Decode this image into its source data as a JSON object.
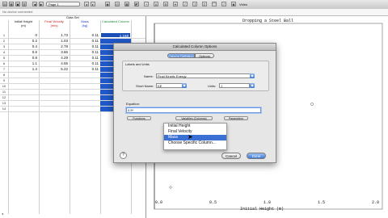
{
  "toolbar": {
    "page_label": "Page 1",
    "video_label": "Video",
    "subbar_text": "No device connected"
  },
  "table": {
    "header": "Data Set",
    "columns": [
      {
        "name": "Initial Height",
        "unit": "(m)"
      },
      {
        "name": "Final Velocity",
        "unit": "(m/s)"
      },
      {
        "name": "Mass",
        "unit": "(kg)"
      },
      {
        "name": "Calculated Column",
        "unit": ""
      }
    ],
    "rows": [
      {
        "n": "1",
        "h": "0",
        "v": "1.73",
        "m": "0.11",
        "c": "1.158"
      },
      {
        "n": "2",
        "h": "0.2",
        "v": "1.03",
        "m": "0.11",
        "c": ""
      },
      {
        "n": "3",
        "h": "0.4",
        "v": "2.78",
        "m": "0.11",
        "c": ""
      },
      {
        "n": "4",
        "h": "0.6",
        "v": "3.66",
        "m": "0.11",
        "c": ""
      },
      {
        "n": "5",
        "h": "0.8",
        "v": "4.29",
        "m": "0.11",
        "c": ""
      },
      {
        "n": "6",
        "h": "1.1",
        "v": "4.65",
        "m": "0.11",
        "c": ""
      },
      {
        "n": "7",
        "h": "1.4",
        "v": "5.22",
        "m": "0.11",
        "c": ""
      },
      {
        "n": "8",
        "h": "",
        "v": "",
        "m": "",
        "c": ""
      },
      {
        "n": "9",
        "h": "",
        "v": "",
        "m": "",
        "c": ""
      },
      {
        "n": "10",
        "h": "",
        "v": "",
        "m": "",
        "c": ""
      },
      {
        "n": "11",
        "h": "",
        "v": "",
        "m": "",
        "c": ""
      },
      {
        "n": "12",
        "h": "",
        "v": "",
        "m": "",
        "c": ""
      },
      {
        "n": "13",
        "h": "",
        "v": "",
        "m": "",
        "c": ""
      },
      {
        "n": "14",
        "h": "",
        "v": "",
        "m": "",
        "c": ""
      }
    ]
  },
  "graph": {
    "title": "Dropping a Steel Ball",
    "xlabel": "Initial Height (m)",
    "ticks": [
      "0.0",
      "0.5",
      "1.0",
      "1.5",
      "2.0"
    ]
  },
  "dialog": {
    "title": "Calculated Column Options",
    "tabs": [
      "Column Definition",
      "Options"
    ],
    "group_label": "Labels and Units",
    "name_label": "Name:",
    "name_value": "Final Kinetic Energy",
    "short_label": "Short Name:",
    "short_value": "KE",
    "units_label": "Units:",
    "units_value": "J",
    "equation_label": "Equation:",
    "equation_value": "0.5*",
    "functions_label": "Functions",
    "variables_label": "Variables (Columns)",
    "parameters_label": "Parameters",
    "cancel_label": "Cancel",
    "done_label": "Done",
    "help_label": "?"
  },
  "menu": {
    "items": [
      "Initial Height",
      "Final Velocity",
      "Mass",
      "Choose Specific Column..."
    ],
    "selected_index": 2
  },
  "colors": {
    "selection": "#3a6fd3",
    "column_highlight": "#1f58c9"
  }
}
